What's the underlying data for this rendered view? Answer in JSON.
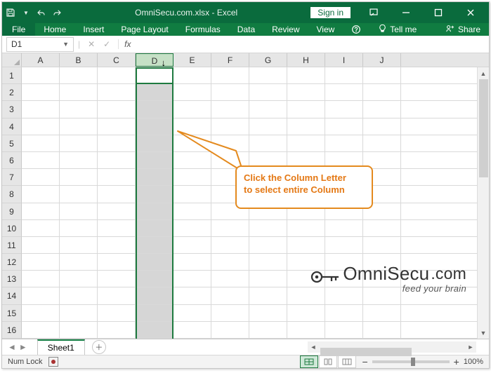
{
  "titlebar": {
    "title": "OmniSecu.com.xlsx - Excel",
    "signin": "Sign in"
  },
  "ribbon": {
    "file": "File",
    "tabs": [
      "Home",
      "Insert",
      "Page Layout",
      "Formulas",
      "Data",
      "Review",
      "View"
    ],
    "tellme": "Tell me",
    "share": "Share"
  },
  "namebox": {
    "value": "D1"
  },
  "formula": {
    "fx": "fx"
  },
  "columns": [
    "A",
    "B",
    "C",
    "D",
    "E",
    "F",
    "G",
    "H",
    "I",
    "J"
  ],
  "rows": [
    "1",
    "2",
    "3",
    "4",
    "5",
    "6",
    "7",
    "8",
    "9",
    "10",
    "11",
    "12",
    "13",
    "14",
    "15",
    "16"
  ],
  "selected_column_index": 3,
  "tab": {
    "sheet1": "Sheet1"
  },
  "statusbar": {
    "numlock": "Num Lock",
    "zoom_minus": "−",
    "zoom_plus": "+",
    "zoom_pct": "100%"
  },
  "callout": {
    "line1": "Click the Column Letter",
    "line2": "to select entire Column"
  },
  "watermark": {
    "brand_prefix": "OmniSecu",
    "brand_suffix": ".com",
    "slogan": "feed your brain"
  }
}
